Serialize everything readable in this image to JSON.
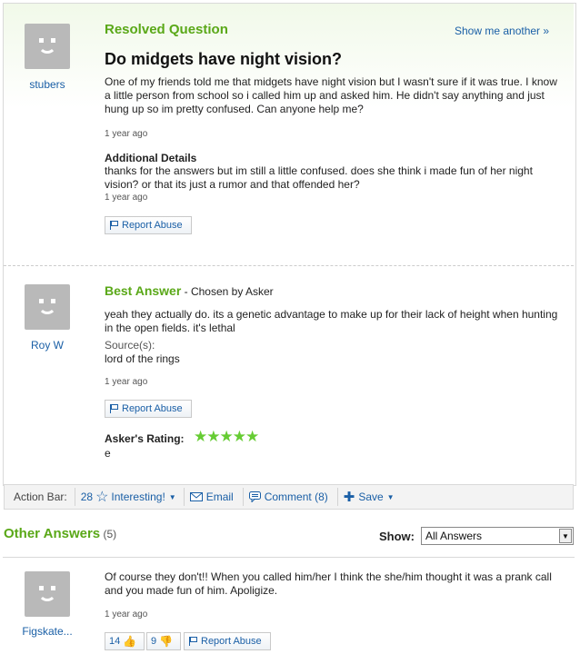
{
  "question": {
    "status_label": "Resolved Question",
    "show_another": "Show me another »",
    "title": "Do midgets have night vision?",
    "asker": "stubers",
    "body": "One of my friends told me that midgets have night vision but I wasn't sure if it was true. I know a little person from school so i called him up and asked him. He didn't say anything and just hung up so im pretty confused. Can anyone help me?",
    "time": "1 year ago",
    "additional_details_label": "Additional Details",
    "additional_details": "thanks for the answers but im still a little confused. does she think i made fun of her night vision? or that its just a rumor and that offended her?",
    "additional_time": "1 year ago",
    "report_abuse": "Report Abuse"
  },
  "best_answer": {
    "label": "Best Answer",
    "chosen_by": " - Chosen by Asker",
    "author": "Roy W",
    "body": "yeah they actually do. its a genetic advantage to make up for their lack of height when hunting in the open fields. it's lethal",
    "sources_label": "Source(s):",
    "sources": "lord of the rings",
    "time": "1 year ago",
    "report_abuse": "Report Abuse",
    "rating_label": "Asker's Rating:",
    "rating_stars": 5,
    "rating_display": "★★★★★",
    "rating_comment": "e"
  },
  "action_bar": {
    "label": "Action Bar:",
    "interesting_count": "28",
    "interesting": "Interesting!",
    "email": "Email",
    "comment": "Comment (8)",
    "save": "Save"
  },
  "other_answers": {
    "label": "Other Answers",
    "count": "(5)",
    "show_label": "Show:",
    "filter_value": "All Answers",
    "answers": [
      {
        "author": "Figskate...",
        "body": "Of course they don't!! When you called him/her I think the she/him thought it was a prank call and you made fun of him. Apoligize.",
        "time": "1 year ago",
        "thumbs_up": "14",
        "thumbs_down": "9",
        "report_abuse": "Report Abuse"
      }
    ]
  },
  "colors": {
    "accent_green": "#5aa818",
    "link_blue": "#1a5fa6",
    "star_green": "#66cc33"
  }
}
